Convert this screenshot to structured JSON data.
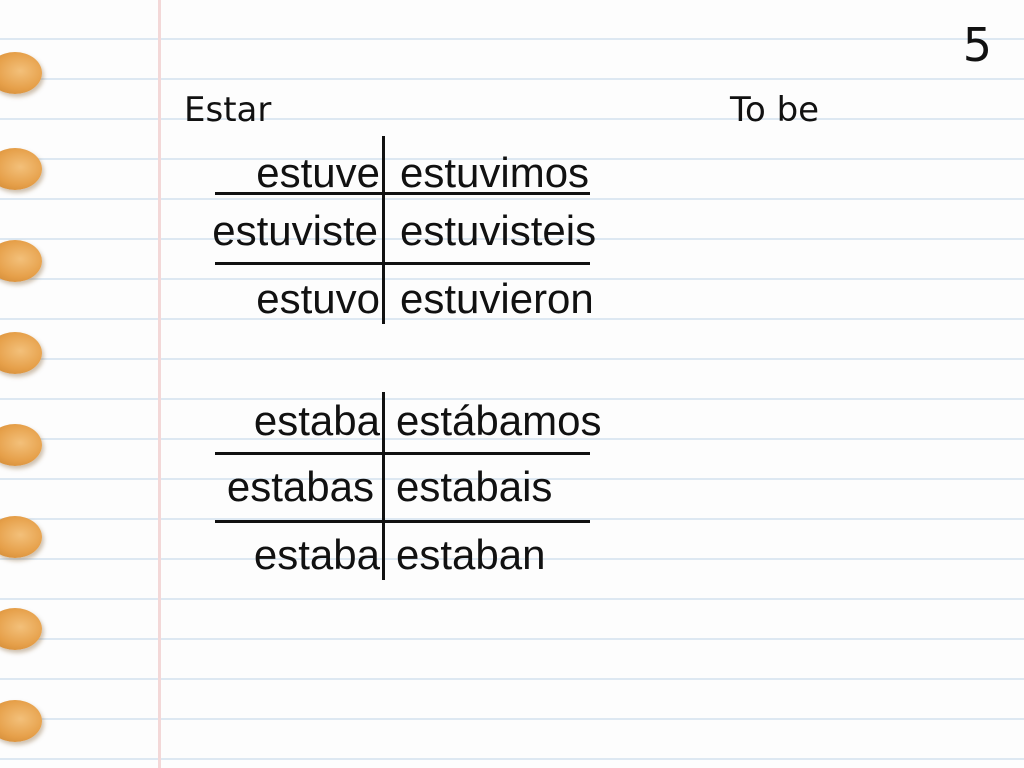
{
  "page_number": "5",
  "heading": {
    "verb": "Estar",
    "translation": "To be"
  },
  "preterite": [
    {
      "singular": "estuve",
      "plural": "estuvimos"
    },
    {
      "singular": "estuviste",
      "plural": "estuvisteis"
    },
    {
      "singular": "estuvo",
      "plural": "estuvieron"
    }
  ],
  "imperfect": [
    {
      "singular": "estaba",
      "plural": "estábamos"
    },
    {
      "singular": "estabas",
      "plural": "estabais"
    },
    {
      "singular": "estaba",
      "plural": "estaban"
    }
  ]
}
